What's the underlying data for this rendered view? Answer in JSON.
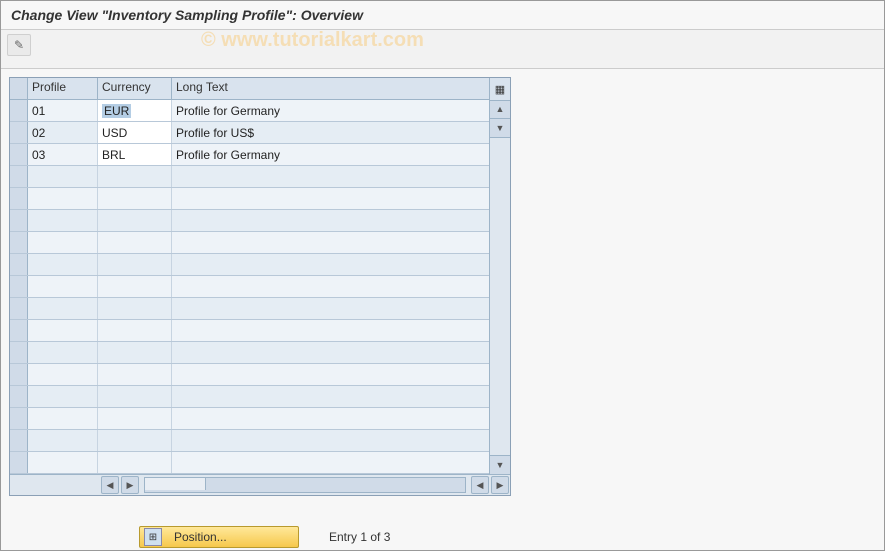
{
  "title": "Change View \"Inventory Sampling Profile\": Overview",
  "watermark": "© www.tutorialkart.com",
  "toolbar": {
    "edit_icon": "✎"
  },
  "grid": {
    "columns": {
      "profile": "Profile",
      "currency": "Currency",
      "long": "Long Text"
    },
    "rows": [
      {
        "profile": "01",
        "currency": "EUR",
        "long": "Profile for Germany"
      },
      {
        "profile": "02",
        "currency": "USD",
        "long": "Profile for US$"
      },
      {
        "profile": "03",
        "currency": "BRL",
        "long": "Profile for Germany"
      }
    ],
    "empty_row_count": 14
  },
  "footer": {
    "position_label": "Position...",
    "entry_text": "Entry 1 of 3"
  }
}
